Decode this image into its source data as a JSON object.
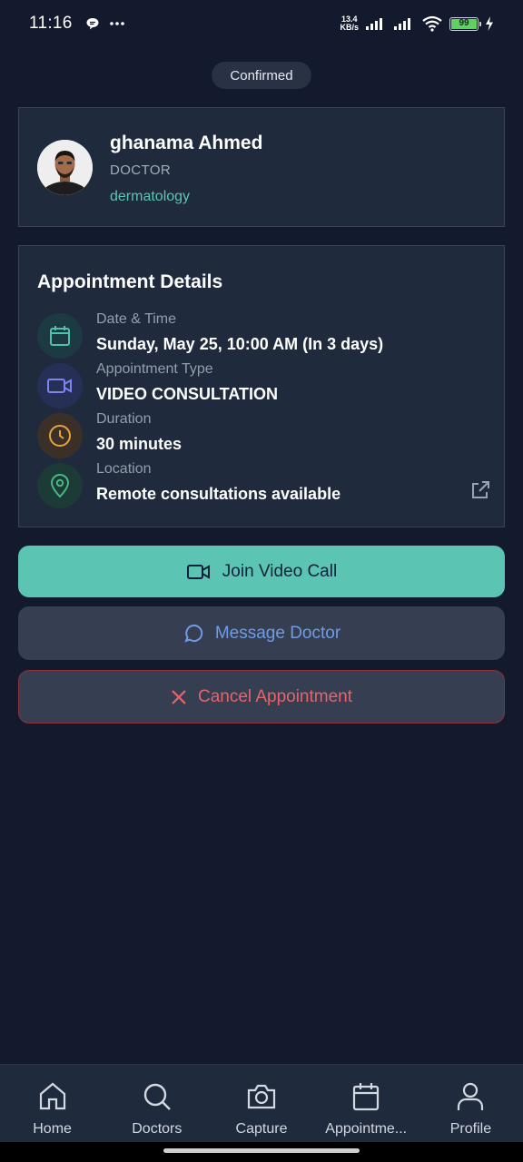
{
  "status_bar": {
    "time": "11:16",
    "net_speed_value": "13.4",
    "net_speed_unit": "KB/s",
    "battery": "99",
    "icons": [
      "chat-bubble-icon",
      "more-dots-icon",
      "signal-icon",
      "signal-icon",
      "wifi-icon",
      "battery-icon",
      "charging-icon"
    ]
  },
  "appointment_status": "Confirmed",
  "doctor": {
    "name": "ghanama Ahmed",
    "role": "DOCTOR",
    "specialty": "dermatology"
  },
  "details": {
    "title": "Appointment Details",
    "items": [
      {
        "label": "Date & Time",
        "value": "Sunday, May 25, 10:00 AM (In 3 days)",
        "icon": "calendar-icon",
        "color": "#4fc1ad"
      },
      {
        "label": "Appointment Type",
        "value": "VIDEO CONSULTATION",
        "icon": "video-camera-icon",
        "color": "#7f85f0"
      },
      {
        "label": "Duration",
        "value": "30 minutes",
        "icon": "clock-icon",
        "color": "#e8a23c"
      },
      {
        "label": "Location",
        "value": "Remote consultations available",
        "icon": "map-pin-icon",
        "color": "#46b882"
      }
    ]
  },
  "actions": {
    "join": "Join Video Call",
    "message": "Message Doctor",
    "cancel": "Cancel Appointment"
  },
  "nav": {
    "items": [
      {
        "label": "Home",
        "icon": "home-icon"
      },
      {
        "label": "Doctors",
        "icon": "search-icon"
      },
      {
        "label": "Capture",
        "icon": "camera-icon"
      },
      {
        "label": "Appointme...",
        "icon": "calendar-icon"
      },
      {
        "label": "Profile",
        "icon": "user-icon"
      }
    ]
  }
}
